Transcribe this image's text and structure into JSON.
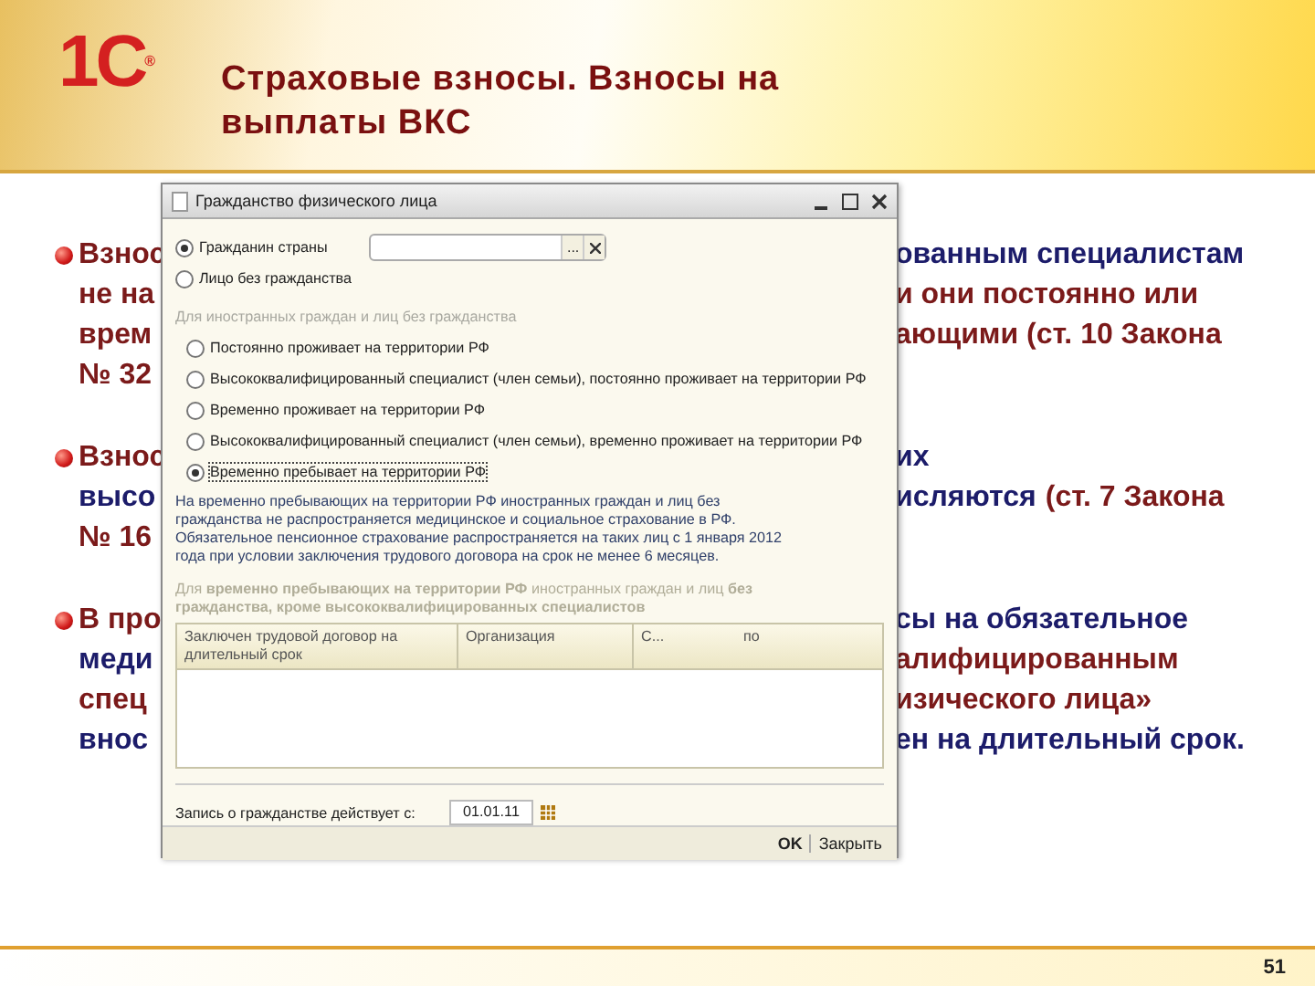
{
  "header": {
    "logo": "1С",
    "logo_mark": "®",
    "title": "Страховые взносы. Взносы на выплаты ВКС"
  },
  "bullets": [
    {
      "left": [
        [
          {
            "text": "Взнос",
            "color": "#7b1a1a"
          }
        ],
        [
          {
            "text": "не на",
            "color": "#7b1a1a"
          }
        ],
        [
          {
            "text": "врем",
            "color": "#7b1a1a"
          }
        ],
        [
          {
            "text": "№ 32",
            "color": "#7b1a1a"
          }
        ]
      ],
      "right": [
        [
          {
            "text": "ованным специалистам",
            "color": "#1c1c6a"
          }
        ],
        [
          {
            "text": "и они постоянно или",
            "color": "#7b1a1a"
          }
        ],
        [
          {
            "text": "ающими (ст. 10 Закона",
            "color": "#7b1a1a"
          }
        ]
      ]
    },
    {
      "left": [
        [
          {
            "text": "Взнос",
            "color": "#7b1a1a"
          }
        ],
        [
          {
            "text": "высо",
            "color": "#1c1c6a"
          }
        ],
        [
          {
            "text": "№ 16",
            "color": "#7b1a1a"
          }
        ]
      ],
      "right": [
        [
          {
            "text": "их",
            "color": "#1c1c6a"
          }
        ],
        [
          {
            "text": "исляются",
            "color": "#1c1c6a"
          },
          {
            "text": "(ст. 7 Закона",
            "color": "#7b1a1a"
          }
        ]
      ]
    },
    {
      "left": [
        [
          {
            "text": "В про",
            "color": "#7b1a1a"
          }
        ],
        [
          {
            "text": "меди",
            "color": "#1c1c6a"
          }
        ],
        [
          {
            "text": "спец",
            "color": "#7b1a1a"
          }
        ],
        [
          {
            "text": "внос",
            "color": "#1c1c6a"
          }
        ]
      ],
      "right": [
        [
          {
            "text": "сы на обязательное",
            "color": "#1c1c6a"
          }
        ],
        [
          {
            "text": "алифицированным",
            "color": "#7b1a1a"
          }
        ],
        [
          {
            "text": "изического лица»",
            "color": "#7b1a1a"
          }
        ],
        [
          {
            "text": "ен на длительный срок.",
            "color": "#1c1c6a"
          }
        ]
      ]
    }
  ],
  "dialog": {
    "title": "Гражданство физического лица",
    "citizenship": [
      {
        "label": "Гражданин страны",
        "selected": true
      },
      {
        "label": "Лицо без гражданства",
        "selected": false
      }
    ],
    "select_button": "...",
    "group_heading": "Для иностранных граждан и лиц без гражданства",
    "statuses": [
      {
        "label": "Постоянно проживает на территории РФ",
        "selected": false
      },
      {
        "label": "Высококвалифицированный специалист (член семьи), постоянно проживает на территории РФ",
        "selected": false
      },
      {
        "label": "Временно проживает на территории РФ",
        "selected": false
      },
      {
        "label": "Высококвалифицированный специалист (член семьи), временно проживает на территории РФ",
        "selected": false
      },
      {
        "label": "Временно пребывает на территории РФ",
        "selected": true
      }
    ],
    "note": "На временно пребывающих на территории РФ иностранных граждан и лиц без гражданства не распространяется медицинское и социальное страхование в РФ. Обязательное пенсионное страхование распространяется на таких лиц с 1 января 2012 года при условии заключения трудового договора на срок не менее 6 месяцев.",
    "table_heading": "Для **временно пребывающих на территории РФ** иностранных граждан и лиц **без гражданства, кроме высококвалифицированных специалистов**",
    "columns": [
      "Заключен трудовой договор на длительный срок",
      "Организация",
      "С...",
      "по"
    ],
    "date_label": "Запись о гражданстве действует с:",
    "date_value": "01.01.11",
    "buttons": [
      "OK",
      "Закрыть"
    ]
  },
  "page_number": "51"
}
